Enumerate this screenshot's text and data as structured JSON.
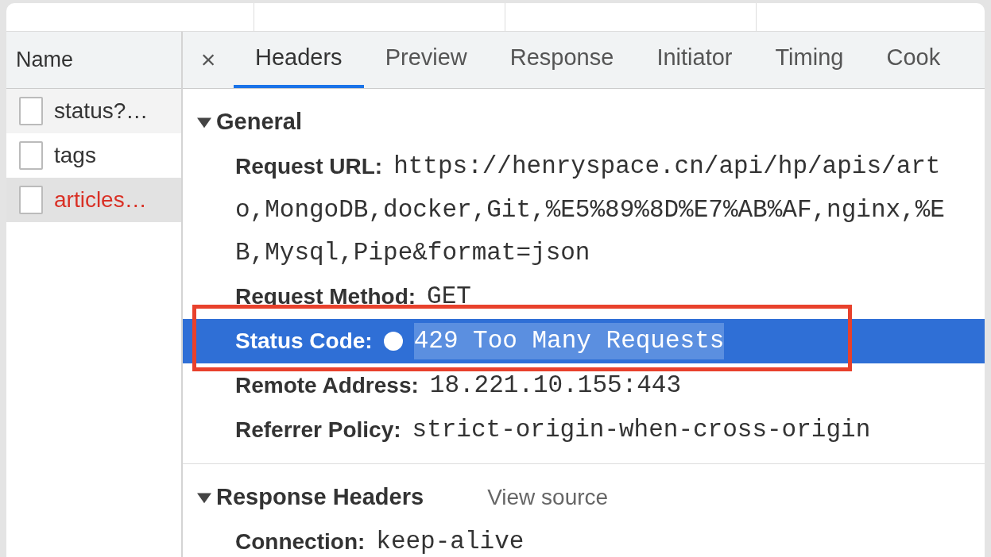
{
  "sidebar": {
    "header": "Name",
    "items": [
      {
        "label": "status?…",
        "selected": false,
        "failed": false
      },
      {
        "label": "tags",
        "selected": false,
        "failed": false
      },
      {
        "label": "articles…",
        "selected": true,
        "failed": true
      }
    ]
  },
  "close": "×",
  "tabs": [
    {
      "label": "Headers",
      "selected": true
    },
    {
      "label": "Preview",
      "selected": false
    },
    {
      "label": "Response",
      "selected": false
    },
    {
      "label": "Initiator",
      "selected": false
    },
    {
      "label": "Timing",
      "selected": false
    },
    {
      "label": "Cook",
      "selected": false
    }
  ],
  "sections": [
    {
      "title": "General",
      "expanded": true,
      "rows": [
        {
          "label": "Request URL:",
          "value_lines": [
            "https://henryspace.cn/api/hp/apis/art",
            "o,MongoDB,docker,Git,%E5%89%8D%E7%AB%AF,nginx,%E",
            "B,Mysql,Pipe&format=json"
          ]
        },
        {
          "label": "Request Method:",
          "value_lines": [
            "GET"
          ]
        },
        {
          "label": "Status Code:",
          "value_lines": [
            "429 Too Many Requests"
          ],
          "status_dot": true,
          "highlighted": true,
          "annotated": true
        },
        {
          "label": "Remote Address:",
          "value_lines": [
            "18.221.10.155:443"
          ]
        },
        {
          "label": "Referrer Policy:",
          "value_lines": [
            "strict-origin-when-cross-origin"
          ]
        }
      ]
    },
    {
      "title": "Response Headers",
      "expanded": true,
      "link": "View source",
      "rows": [
        {
          "label": "Connection:",
          "value_lines": [
            "keep-alive"
          ]
        }
      ]
    }
  ]
}
